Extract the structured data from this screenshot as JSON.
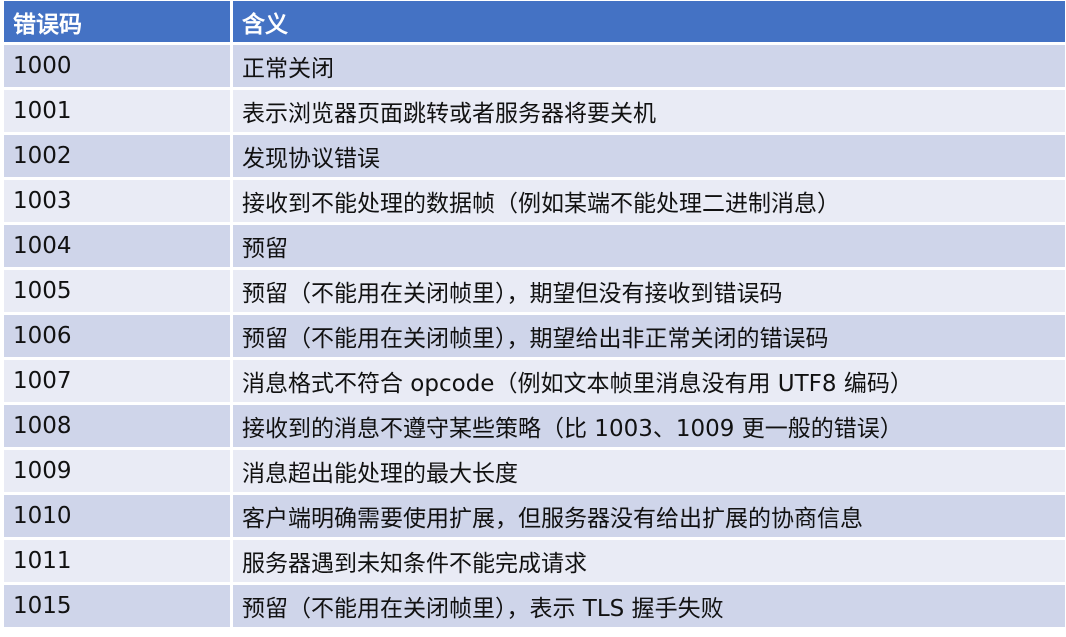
{
  "table": {
    "headers": [
      "错误码",
      "含义"
    ],
    "rows": [
      {
        "code": "1000",
        "meaning": "正常关闭"
      },
      {
        "code": "1001",
        "meaning": "表示浏览器页面跳转或者服务器将要关机"
      },
      {
        "code": "1002",
        "meaning": "发现协议错误"
      },
      {
        "code": "1003",
        "meaning": "接收到不能处理的数据帧（例如某端不能处理二进制消息）"
      },
      {
        "code": "1004",
        "meaning": "预留"
      },
      {
        "code": "1005",
        "meaning": "预留（不能用在关闭帧里），期望但没有接收到错误码"
      },
      {
        "code": "1006",
        "meaning": "预留（不能用在关闭帧里），期望给出非正常关闭的错误码"
      },
      {
        "code": "1007",
        "meaning": "消息格式不符合 opcode（例如文本帧里消息没有用 UTF8 编码）"
      },
      {
        "code": "1008",
        "meaning": "接收到的消息不遵守某些策略（比 1003、1009 更一般的错误）"
      },
      {
        "code": "1009",
        "meaning": "消息超出能处理的最大长度"
      },
      {
        "code": "1010",
        "meaning": "客户端明确需要使用扩展，但服务器没有给出扩展的协商信息"
      },
      {
        "code": "1011",
        "meaning": "服务器遇到未知条件不能完成请求"
      },
      {
        "code": "1015",
        "meaning": "预留（不能用在关闭帧里），表示 TLS 握手失败"
      }
    ]
  },
  "colors": {
    "header_bg": "#4472c4",
    "row_odd_bg": "#cfd5ea",
    "row_even_bg": "#e9ebf5"
  }
}
